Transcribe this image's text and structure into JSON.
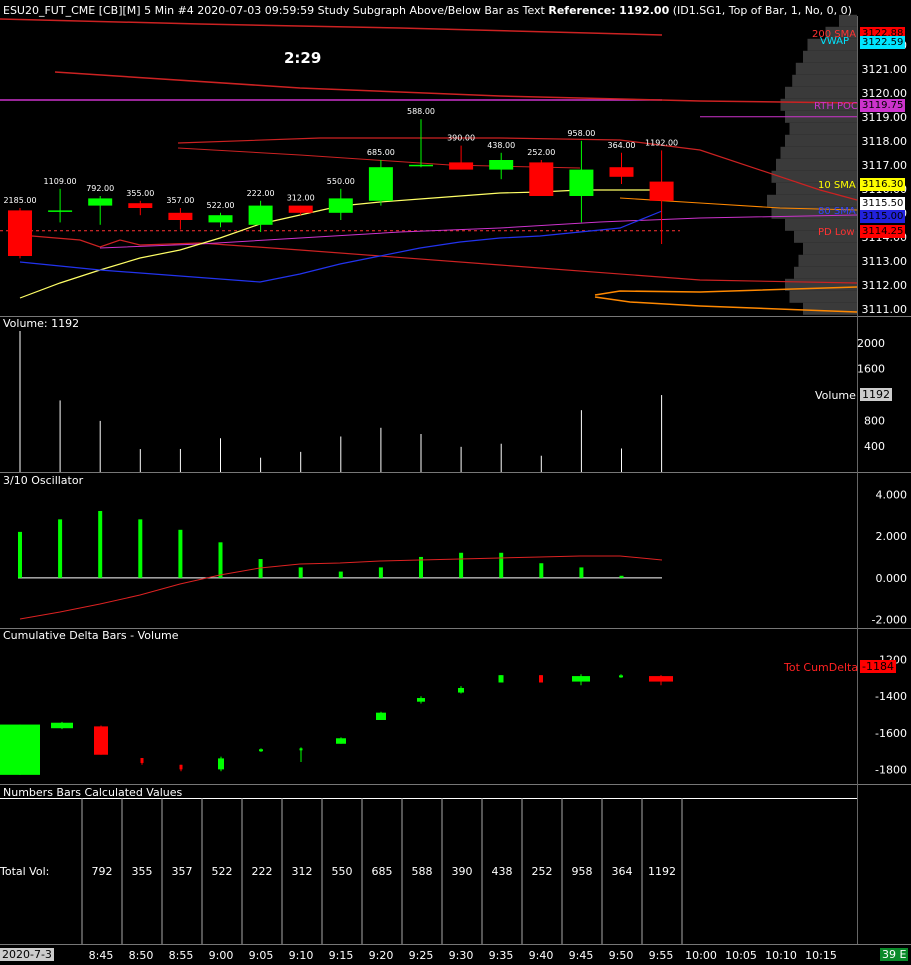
{
  "header": {
    "main": "ESU20_FUT_CME [CB][M]  5 Min   #4 2020-07-03 09:59:59 Study Subgraph Above/Below Bar as Text",
    "reference_label": "Reference:",
    "reference_value": "1192.00",
    "params": "(ID1.SG1, Top of Bar, 1, No, 0, 0)",
    "timer": "2:29"
  },
  "price_panel": {
    "axis_ticks": [
      "3122.00",
      "3121.00",
      "3120.00",
      "3119.00",
      "3118.00",
      "3117.00",
      "3116.00",
      "3115.00",
      "3114.00",
      "3113.00",
      "3112.00",
      "3111.00"
    ],
    "tags": {
      "sma200": {
        "label": "200 SMA",
        "value": "3122.88",
        "color": "#ff0000"
      },
      "vwap": {
        "label": "VWAP",
        "value": "3122.59",
        "color": "#00e5ff"
      },
      "rth_poc": {
        "label": "RTH POC",
        "value": "3119.75",
        "color": "#cc33cc"
      },
      "sma10": {
        "label": "10 SMA",
        "value": "3116.30",
        "color": "#ffff00"
      },
      "last": {
        "value": "3115.50"
      },
      "sma80": {
        "label": "80 SMA",
        "value": "3115.00",
        "color": "#2222dd"
      },
      "pd_low": {
        "label": "PD Low",
        "value": "3114.25",
        "color": "#ff0000"
      }
    },
    "bar_labels": [
      "2185.00",
      "1109.00",
      "792.00",
      "355.00",
      "357.00",
      "522.00",
      "222.00",
      "312.00",
      "550.00",
      "685.00",
      "588.00",
      "390.00",
      "438.00",
      "252.00",
      "958.00",
      "364.00",
      "1192.00"
    ]
  },
  "volume_panel": {
    "title": "Volume: 1192",
    "axis_ticks": [
      "2000",
      "1600",
      "1200",
      "800",
      "400"
    ],
    "label": "Volume",
    "value": "1192"
  },
  "oscillator_panel": {
    "title": "3/10 Oscillator",
    "axis_ticks": [
      "4.000",
      "2.000",
      "0.000",
      "-2.000"
    ]
  },
  "cumdelta_panel": {
    "title": "Cumulative Delta Bars - Volume",
    "axis_ticks": [
      "-1200",
      "-1400",
      "-1600",
      "-1800"
    ],
    "tag_label": "Tot CumDelta",
    "tag_value": "-1184"
  },
  "numbers_panel": {
    "title": "Numbers Bars Calculated Values",
    "row_label": "Total Vol:",
    "values": [
      "792",
      "355",
      "357",
      "522",
      "222",
      "312",
      "550",
      "685",
      "588",
      "390",
      "438",
      "252",
      "958",
      "364",
      "1192"
    ]
  },
  "time_axis": {
    "date": "2020-7-3",
    "ticks": [
      "8:45",
      "8:50",
      "8:55",
      "9:00",
      "9:05",
      "9:10",
      "9:15",
      "9:20",
      "9:25",
      "9:30",
      "9:35",
      "9:40",
      "9:45",
      "9:50",
      "9:55",
      "10:00",
      "10:05",
      "10:10",
      "10:15"
    ],
    "corner": "39 E"
  },
  "chart_data": {
    "type": "candlestick",
    "bars": [
      {
        "open": 3115.1,
        "high": 3115.2,
        "low": 3113.1,
        "close": 3113.2,
        "volume": 2185,
        "osc": 2.2
      },
      {
        "open": 3115.1,
        "high": 3116.0,
        "low": 3114.6,
        "close": 3115.1,
        "volume": 1109,
        "osc": 2.8
      },
      {
        "open": 3115.3,
        "high": 3115.7,
        "low": 3114.5,
        "close": 3115.6,
        "volume": 792,
        "osc": 3.2
      },
      {
        "open": 3115.4,
        "high": 3115.5,
        "low": 3114.9,
        "close": 3115.2,
        "volume": 355,
        "osc": 2.8
      },
      {
        "open": 3115.0,
        "high": 3115.2,
        "low": 3114.3,
        "close": 3114.7,
        "volume": 357,
        "osc": 2.3
      },
      {
        "open": 3114.6,
        "high": 3115.0,
        "low": 3114.4,
        "close": 3114.9,
        "volume": 522,
        "osc": 1.7
      },
      {
        "open": 3114.5,
        "high": 3115.5,
        "low": 3114.2,
        "close": 3115.3,
        "volume": 222,
        "osc": 0.9
      },
      {
        "open": 3115.3,
        "high": 3115.3,
        "low": 3114.9,
        "close": 3115.0,
        "volume": 312,
        "osc": 0.5
      },
      {
        "open": 3115.0,
        "high": 3116.0,
        "low": 3114.7,
        "close": 3115.6,
        "volume": 550,
        "osc": 0.3
      },
      {
        "open": 3115.5,
        "high": 3117.2,
        "low": 3115.3,
        "close": 3116.9,
        "volume": 685,
        "osc": 0.5
      },
      {
        "open": 3117.0,
        "high": 3118.9,
        "low": 3116.9,
        "close": 3117.0,
        "volume": 588,
        "osc": 1.0
      },
      {
        "open": 3117.1,
        "high": 3117.8,
        "low": 3116.8,
        "close": 3116.8,
        "volume": 390,
        "osc": 1.2
      },
      {
        "open": 3116.8,
        "high": 3117.5,
        "low": 3116.4,
        "close": 3117.2,
        "volume": 438,
        "osc": 1.2
      },
      {
        "open": 3117.1,
        "high": 3117.2,
        "low": 3115.7,
        "close": 3115.7,
        "volume": 252,
        "osc": 0.7
      },
      {
        "open": 3115.7,
        "high": 3118.0,
        "low": 3114.6,
        "close": 3116.8,
        "volume": 958,
        "osc": 0.5
      },
      {
        "open": 3116.9,
        "high": 3117.5,
        "low": 3116.2,
        "close": 3116.5,
        "volume": 364,
        "osc": 0.1
      },
      {
        "open": 3116.3,
        "high": 3117.6,
        "low": 3113.7,
        "close": 3115.5,
        "volume": 1192,
        "osc": 0.0
      }
    ],
    "cumdelta": [
      {
        "open": -1555,
        "high": -1555,
        "low": -1830,
        "close": -1830
      },
      {
        "open": -1545,
        "high": -1540,
        "low": -1580,
        "close": -1575
      },
      {
        "open": -1575,
        "high": -1565,
        "low": -1720,
        "close": -1720
      },
      {
        "open": -1738,
        "high": -1738,
        "low": -1775,
        "close": -1765
      },
      {
        "open": -1775,
        "high": -1775,
        "low": -1810,
        "close": -1800
      },
      {
        "open": -1730,
        "high": -1720,
        "low": -1810,
        "close": -1800
      },
      {
        "open": -1700,
        "high": -1690,
        "low": -1700,
        "close": -1690
      },
      {
        "open": -1695,
        "high": -1685,
        "low": -1760,
        "close": -1690
      },
      {
        "open": -1660,
        "high": -1630,
        "low": -1660,
        "close": -1630
      },
      {
        "open": -1640,
        "high": -1640,
        "low": -1690,
        "close": -1640
      },
      {
        "open": -1520,
        "high": -1500,
        "low": -1530,
        "close": -1510
      },
      {
        "open": -1410,
        "high": -1405,
        "low": -1430,
        "close": -1420
      },
      {
        "open": -1340,
        "high": -1340,
        "low": -1350,
        "close": -1350
      },
      {
        "open": -1290,
        "high": -1280,
        "low": -1300,
        "close": -1290
      },
      {
        "open": -1200,
        "high": -1200,
        "low": -1200,
        "close": -1200
      },
      {
        "open": -1300,
        "high": -1290,
        "low": -1310,
        "close": -1310
      },
      {
        "open": -1195,
        "high": -1190,
        "low": -1200,
        "close": -1190
      },
      {
        "open": -1190,
        "high": -1170,
        "low": -1320,
        "close": -1190
      },
      {
        "open": -1180,
        "high": -1170,
        "low": -1190,
        "close": -1180
      },
      {
        "open": -1170,
        "high": -1165,
        "low": -1240,
        "close": -1240
      }
    ],
    "price_range": [
      3110.7,
      3123.2
    ],
    "volume_range": [
      0,
      2200
    ],
    "osc_range": [
      -2.4,
      4.3
    ],
    "cumdelta_range": [
      -1880,
      -1120
    ],
    "colors": {
      "up": "#00ff00",
      "down": "#ff0000",
      "sma10": "#ffff00",
      "sma80": "#2222dd",
      "sma200": "#ff0000",
      "profile": "#444444"
    }
  }
}
